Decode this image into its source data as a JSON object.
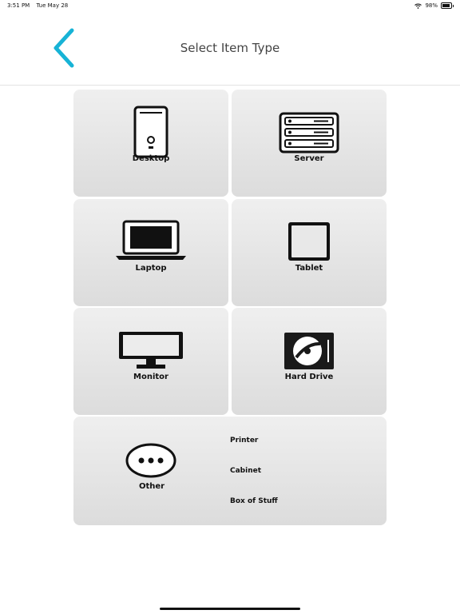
{
  "status": {
    "time": "3:51 PM",
    "date": "Tue May 28",
    "battery": "98%"
  },
  "header": {
    "title": "Select Item Type",
    "back_icon": "chevron-left-icon",
    "accent": "#17b3d6"
  },
  "tiles": [
    {
      "label": "Desktop",
      "icon": "desktop-tower-icon"
    },
    {
      "label": "Server",
      "icon": "server-rack-icon"
    },
    {
      "label": "Laptop",
      "icon": "laptop-icon"
    },
    {
      "label": "Tablet",
      "icon": "tablet-icon"
    },
    {
      "label": "Monitor",
      "icon": "monitor-icon"
    },
    {
      "label": "Hard Drive",
      "icon": "hard-drive-icon"
    }
  ],
  "other": {
    "label": "Other",
    "icon": "more-dots-icon",
    "options": [
      "Printer",
      "Cabinet",
      "Box of Stuff"
    ]
  }
}
